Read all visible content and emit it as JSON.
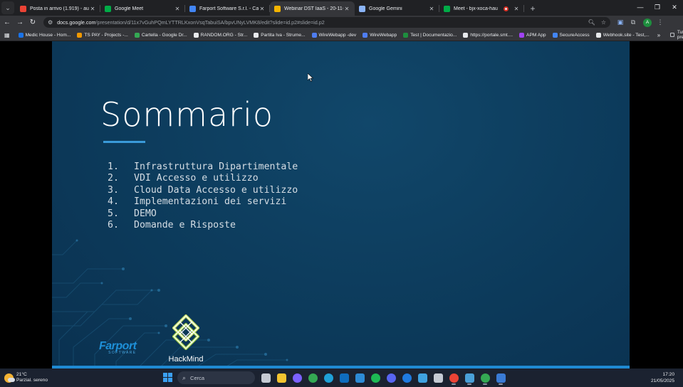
{
  "browser": {
    "tabs": [
      {
        "title": "Posta in arrivo (1.919) - augusto",
        "favicon": "gmail-icon",
        "color": "#ea4335",
        "active": false
      },
      {
        "title": "Google Meet",
        "favicon": "google-meet-icon",
        "color": "#00ac47",
        "active": false
      },
      {
        "title": "Farport Software S.r.l. - Calendar",
        "favicon": "calendar-icon",
        "color": "#4285f4",
        "active": false
      },
      {
        "title": "Webinar DST IaaS - 20-11-24 - Presentazioni",
        "favicon": "google-slides-icon",
        "color": "#f4b400",
        "active": true
      },
      {
        "title": "Google Gemini",
        "favicon": "gemini-icon",
        "color": "#8ab4f8",
        "active": false
      },
      {
        "title": "Meet - bjx-xoca-hau",
        "favicon": "google-meet-icon",
        "color": "#00ac47",
        "active": false,
        "recording": true
      }
    ],
    "url_host": "docs.google.com",
    "url_path": "/presentation/d/11x7vGuhPQmLYTTRLKxonVsqTabuiSA/bpvUNyLVMK8/edit?slide=id.p2#slide=id.p2",
    "profile_initial": "A",
    "bookmarks": [
      {
        "label": "Medic House - Hom...",
        "color": "#1a73e8"
      },
      {
        "label": "TS PAY - Projects -...",
        "color": "#f29900"
      },
      {
        "label": "Cartella - Google Dr...",
        "color": "#34a853"
      },
      {
        "label": "RANDOM.ORG - Str...",
        "color": "#e8eaed"
      },
      {
        "label": "Partita Iva - Strume...",
        "color": "#e8eaed"
      },
      {
        "label": "WireWebapp -dev",
        "color": "#4e7df1"
      },
      {
        "label": "WireWebapp",
        "color": "#4e7df1"
      },
      {
        "label": "Test | Documentazio...",
        "color": "#1e8e3e"
      },
      {
        "label": "https://portale.smt....",
        "color": "#e8eaed"
      },
      {
        "label": "APM App",
        "color": "#a142f4"
      },
      {
        "label": "SecureAccess",
        "color": "#4285f4"
      },
      {
        "label": "Webhook.site - Test,...",
        "color": "#e8eaed"
      }
    ],
    "bookmarks_all_label": "Tutti i preferiti"
  },
  "slide": {
    "title": "Sommario",
    "agenda": [
      {
        "num": "1.",
        "text": "Infrastruttura Dipartimentale"
      },
      {
        "num": "2.",
        "text": "VDI Accesso e utilizzo"
      },
      {
        "num": "3.",
        "text": "Cloud Data Accesso e utilizzo"
      },
      {
        "num": "4.",
        "text": "Implementazioni dei servizi"
      },
      {
        "num": "5.",
        "text": "DEMO"
      },
      {
        "num": "6.",
        "text": "Domande e Risposte"
      }
    ],
    "logo_farport": "Farport",
    "logo_farport_sub": "SOFTWARE",
    "logo_hackmind": "HackMind",
    "accent_color": "#1f8ad3"
  },
  "taskbar": {
    "weather_temp": "21°C",
    "weather_desc": "Parzial. sereno",
    "search_placeholder": "Cerca",
    "time": "17:20",
    "date": "21/05/2025",
    "apps": [
      {
        "name": "task-view-icon",
        "color": "#c5cad3"
      },
      {
        "name": "file-explorer-icon",
        "color": "#f4c430"
      },
      {
        "name": "copilot-icon",
        "color": "#7b61ff"
      },
      {
        "name": "chrome-icon",
        "color": "#34a853"
      },
      {
        "name": "edge-icon",
        "color": "#1fa1d8"
      },
      {
        "name": "outlook-icon",
        "color": "#0f6cbd"
      },
      {
        "name": "microsoft-store-icon",
        "color": "#2d8bd6"
      },
      {
        "name": "spotify-icon",
        "color": "#1db954"
      },
      {
        "name": "discord-icon",
        "color": "#5865f2"
      },
      {
        "name": "arc-icon",
        "color": "#1f7ae0"
      },
      {
        "name": "notepad-icon",
        "color": "#3fa2e0"
      },
      {
        "name": "vpn-icon",
        "color": "#c5cad3"
      },
      {
        "name": "chrome-profile-icon",
        "color": "#ea4335"
      },
      {
        "name": "teams-icon",
        "color": "#4aa0d8"
      },
      {
        "name": "chrome-active-icon",
        "color": "#34a853"
      },
      {
        "name": "shield-app-icon",
        "color": "#3a7bd5"
      }
    ]
  }
}
